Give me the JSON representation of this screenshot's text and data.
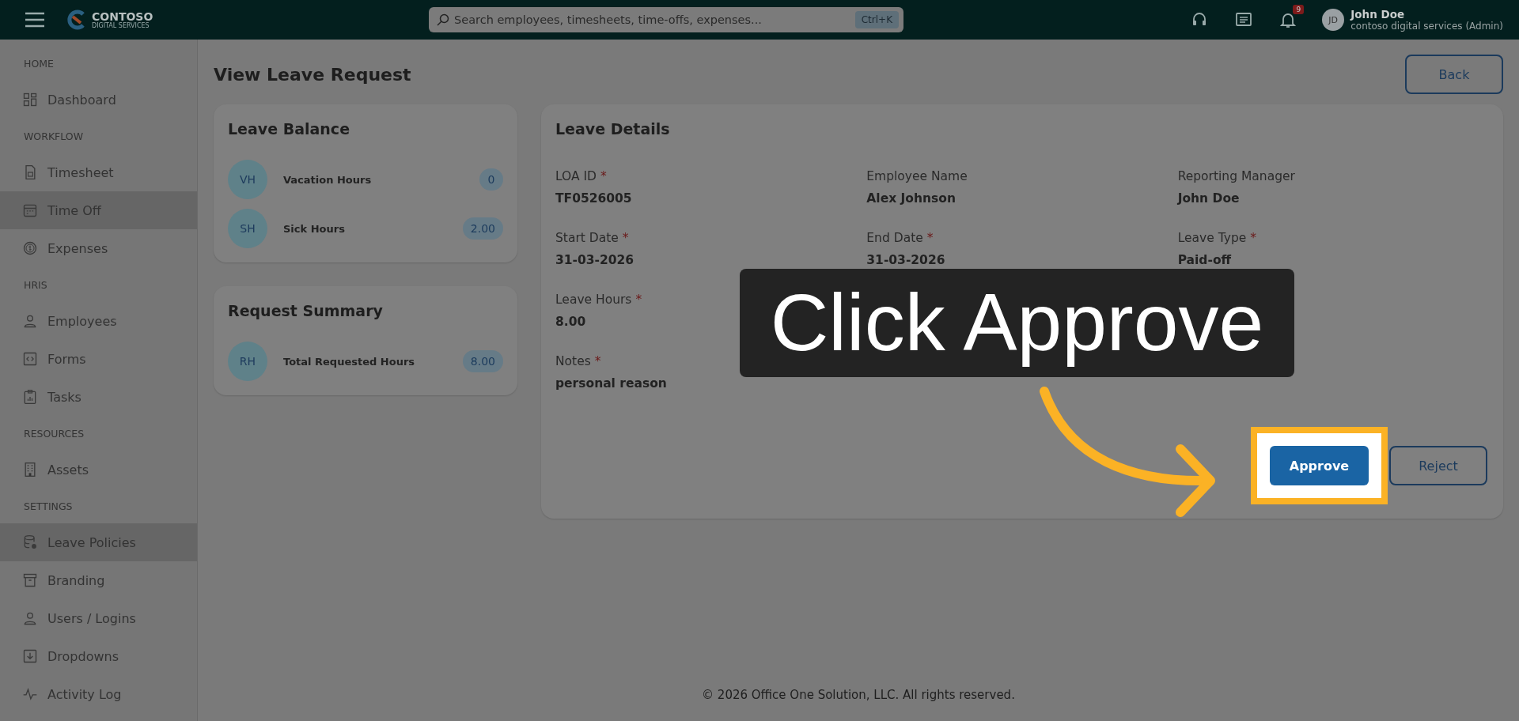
{
  "topbar": {
    "logo": {
      "name": "CONTOSO",
      "tagline": "DIGITAL SERVICES"
    },
    "search": {
      "placeholder": "Search employees, timesheets, time-offs, expenses...",
      "shortcut": "Ctrl+K"
    },
    "notifications": {
      "count": "9"
    },
    "user": {
      "initials": "JD",
      "name": "John Doe",
      "org": "contoso digital services (Admin)"
    }
  },
  "sidebar": {
    "sections": [
      {
        "title": "HOME",
        "items": [
          {
            "label": "Dashboard",
            "selected": false
          }
        ]
      },
      {
        "title": "WORKFLOW",
        "items": [
          {
            "label": "Timesheet",
            "selected": false
          },
          {
            "label": "Time Off",
            "selected": true
          },
          {
            "label": "Expenses",
            "selected": false
          }
        ]
      },
      {
        "title": "HRIS",
        "items": [
          {
            "label": "Employees",
            "selected": false
          },
          {
            "label": "Forms",
            "selected": false
          },
          {
            "label": "Tasks",
            "selected": false
          }
        ]
      },
      {
        "title": "RESOURCES",
        "items": [
          {
            "label": "Assets",
            "selected": false
          }
        ]
      },
      {
        "title": "SETTINGS",
        "items": [
          {
            "label": "Leave Policies",
            "selected": true
          },
          {
            "label": "Branding",
            "selected": false
          },
          {
            "label": "Users / Logins",
            "selected": false
          },
          {
            "label": "Dropdowns",
            "selected": false
          },
          {
            "label": "Activity Log",
            "selected": false
          }
        ]
      }
    ]
  },
  "page": {
    "title": "View Leave Request",
    "back_button": "Back"
  },
  "leave_balance": {
    "title": "Leave Balance",
    "items": [
      {
        "initials": "VH",
        "label": "Vacation Hours",
        "value": "0"
      },
      {
        "initials": "SH",
        "label": "Sick Hours",
        "value": "2.00"
      }
    ]
  },
  "request_summary": {
    "title": "Request Summary",
    "items": [
      {
        "initials": "RH",
        "label": "Total Requested Hours",
        "value": "8.00"
      }
    ]
  },
  "leave_details": {
    "title": "Leave Details",
    "rows": [
      [
        {
          "label": "LOA ID",
          "value": "TF0526005",
          "required_mark": "*"
        },
        {
          "label": "Employee Name",
          "value": "Alex Johnson"
        },
        {
          "label": "Reporting Manager",
          "value": "John Doe"
        }
      ],
      [
        {
          "label": "Start Date",
          "value": "31-03-2026",
          "required_mark": "*"
        },
        {
          "label": "End Date",
          "value": "31-03-2026",
          "required_mark": "*"
        },
        {
          "label": "Leave Type",
          "value": "Paid-off",
          "required_mark": "*"
        }
      ],
      [
        {
          "label": "Leave Hours",
          "value": "8.00",
          "required_mark": "*"
        }
      ],
      [
        {
          "label": "Notes",
          "value": "personal reason",
          "required_mark": "*"
        }
      ]
    ],
    "actions": [
      {
        "label": "Approve",
        "kind": "primary",
        "highlighted": true
      },
      {
        "label": "Reject",
        "kind": "outline",
        "highlighted": false
      }
    ]
  },
  "footer": "© 2026 Office One Solution, LLC. All rights reserved.",
  "callout": {
    "text": "Click Approve"
  }
}
